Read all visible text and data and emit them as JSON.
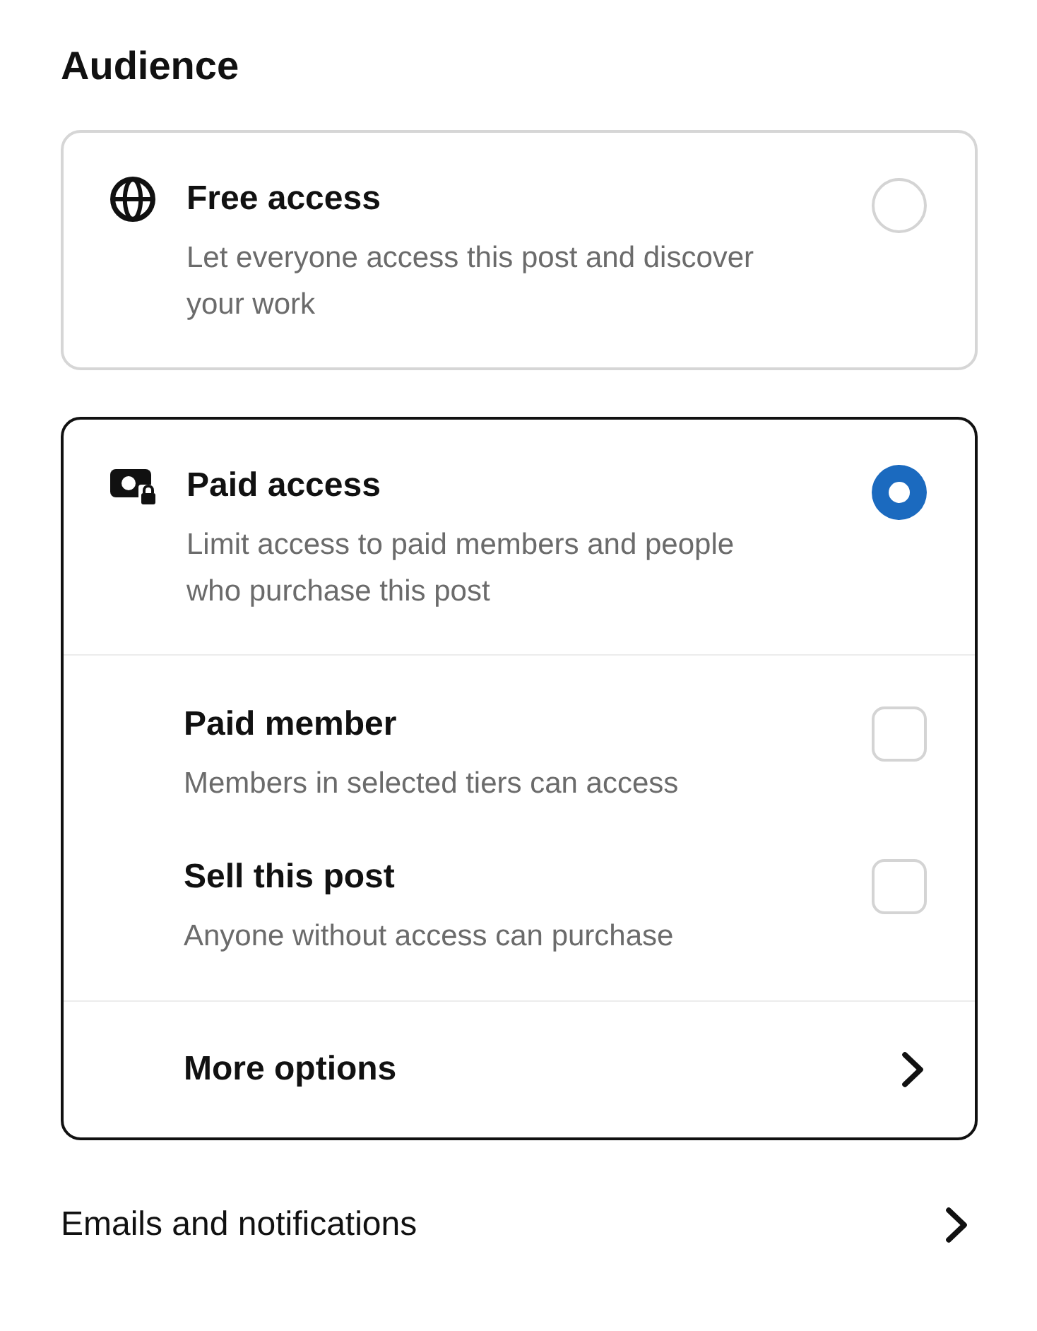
{
  "heading": "Audience",
  "options": [
    {
      "kind": "free",
      "title": "Free access",
      "description": "Let everyone access this post and discover your work",
      "selected": false
    },
    {
      "kind": "paid",
      "title": "Paid access",
      "description": "Limit access to paid members and people who purchase this post",
      "selected": true,
      "sub_options": [
        {
          "title": "Paid member",
          "description": "Members in selected tiers can access",
          "checked": false
        },
        {
          "title": "Sell this post",
          "description": "Anyone without access can purchase",
          "checked": false
        }
      ],
      "more_options": "More options"
    }
  ],
  "emails_link": "Emails and notifications"
}
